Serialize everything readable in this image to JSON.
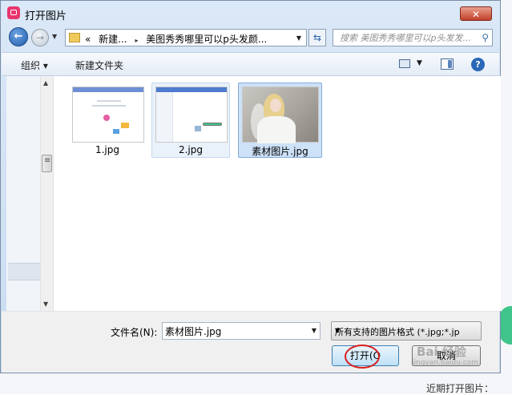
{
  "dialog": {
    "title": "打开图片",
    "close_label": "✕"
  },
  "nav": {
    "back_glyph": "←",
    "forward_glyph": "→",
    "breadcrumbs": [
      "«",
      "新建...",
      "▸",
      "美图秀秀哪里可以p头发颜..."
    ],
    "search_placeholder": "搜索 美图秀秀哪里可以p头发发..."
  },
  "toolbar": {
    "organize_label": "组织 ▾",
    "new_folder_label": "新建文件夹",
    "help_label": "?"
  },
  "files": [
    {
      "name": "1.jpg",
      "state": "normal"
    },
    {
      "name": "2.jpg",
      "state": "hover"
    },
    {
      "name": "素材图片.jpg",
      "state": "selected"
    }
  ],
  "footer": {
    "filename_label": "文件名(N):",
    "filename_value": "素材图片.jpg",
    "filetype_value": "所有支持的图片格式 (*.jpg;*.jp",
    "open_label": "打开(O",
    "cancel_label": "取消"
  },
  "background": {
    "recent_text": "近期打开图片："
  },
  "watermark": {
    "brand": "Bai 经验",
    "url": "jingyan.baidu.com"
  },
  "colors": {
    "accent": "#2a67b6",
    "close_red": "#c2402a",
    "annotation_red": "#d71f1f"
  }
}
